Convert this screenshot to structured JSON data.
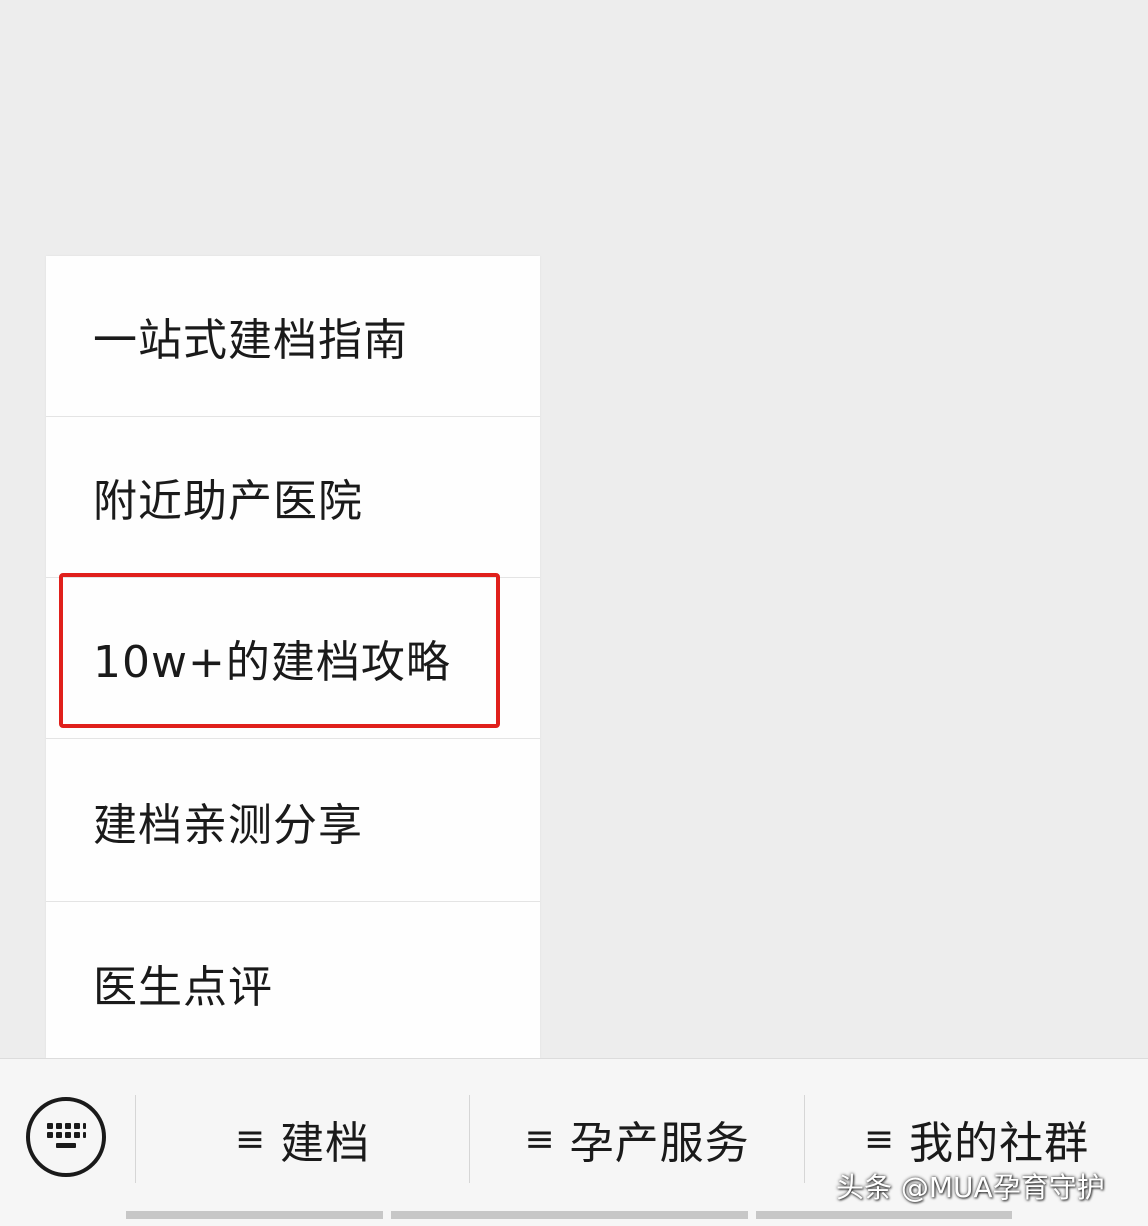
{
  "menu": {
    "items": [
      {
        "label": "一站式建档指南"
      },
      {
        "label": "附近助产医院"
      },
      {
        "label": "10w+的建档攻略"
      },
      {
        "label": "建档亲测分享"
      },
      {
        "label": "医生点评"
      }
    ],
    "highlighted_index": 2,
    "highlight_color": "#e0201c"
  },
  "bottom_bar": {
    "keyboard_icon": "keyboard-icon",
    "tabs": [
      {
        "icon": "≡",
        "label": "建档"
      },
      {
        "icon": "≡",
        "label": "孕产服务"
      },
      {
        "icon": "≡",
        "label": "我的社群"
      }
    ]
  },
  "watermark": {
    "text": "头条 @MUA孕育守护"
  }
}
